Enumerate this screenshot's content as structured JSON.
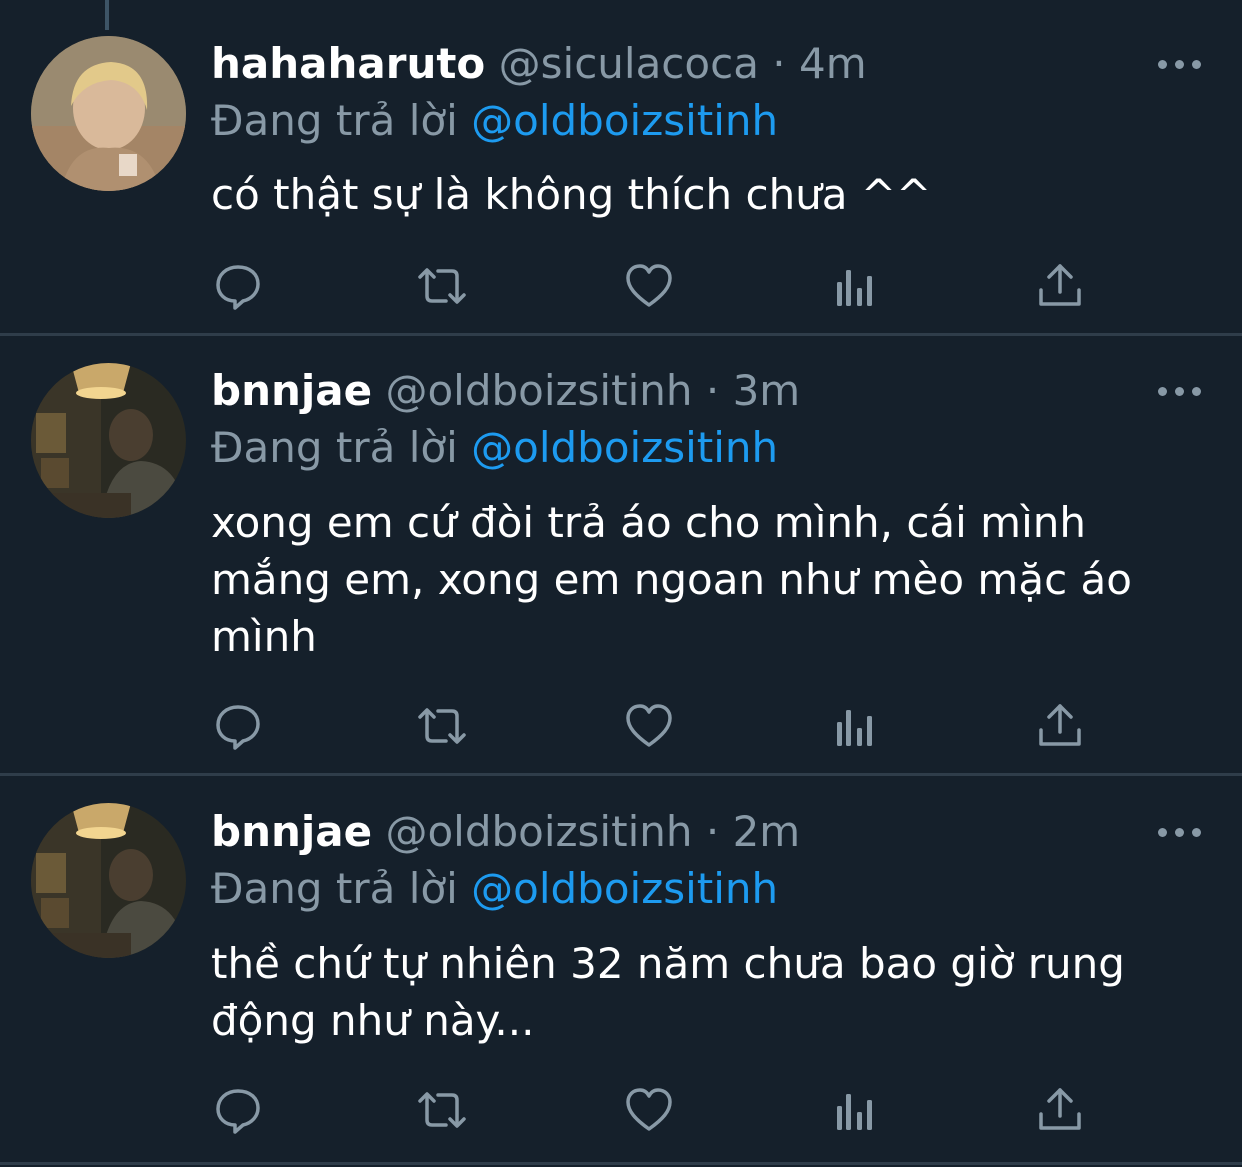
{
  "colors": {
    "background": "#15202b",
    "divider": "#2f3d4a",
    "muted_text": "#8899a6",
    "mention": "#1d9bf0",
    "primary_text": "#ffffff"
  },
  "tweets": [
    {
      "display_name": "hahaharuto",
      "handle": "@siculacoca",
      "separator": "·",
      "time": "4m",
      "reply_label": "Đang trả lời",
      "reply_to": "@oldboizsitinh",
      "text": "có thật sự là không thích chưa ^^",
      "avatar_icon": "user-photo-blonde"
    },
    {
      "display_name": "bnnjae",
      "handle": "@oldboizsitinh",
      "separator": "·",
      "time": "3m",
      "reply_label": "Đang trả lời",
      "reply_to": "@oldboizsitinh",
      "text": "xong em cứ đòi trả áo cho mình, cái mình mắng em, xong em ngoan như mèo mặc áo mình",
      "avatar_icon": "user-photo-lamp-room"
    },
    {
      "display_name": "bnnjae",
      "handle": "@oldboizsitinh",
      "separator": "·",
      "time": "2m",
      "reply_label": "Đang trả lời",
      "reply_to": "@oldboizsitinh",
      "text": "thề chứ tự nhiên 32 năm chưa bao giờ rung động như này...",
      "avatar_icon": "user-photo-lamp-room"
    }
  ],
  "action_icons": [
    "reply-icon",
    "retweet-icon",
    "like-icon",
    "analytics-icon",
    "share-icon"
  ]
}
